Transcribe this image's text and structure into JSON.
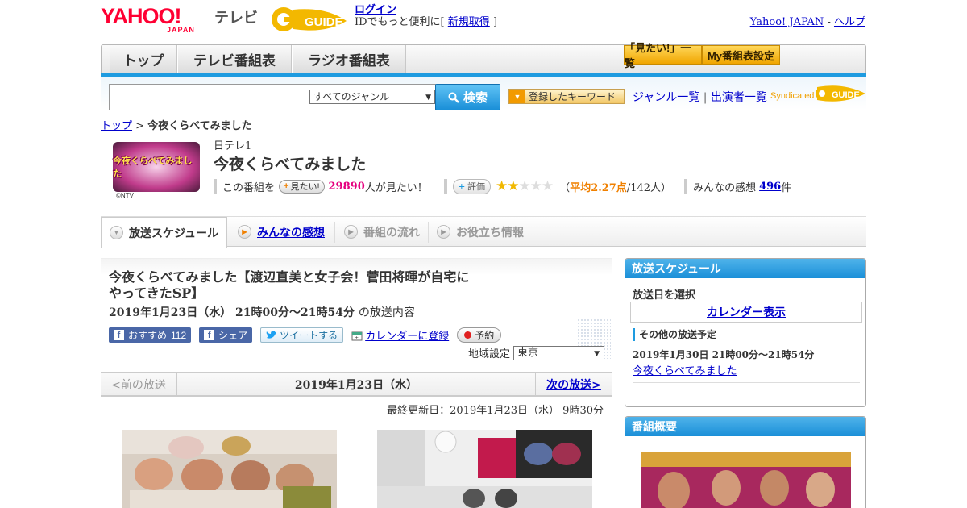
{
  "header": {
    "yahoo_logo": "YAHOO!",
    "yahoo_logo_sub": "JAPAN",
    "tv_label": "テレビ",
    "gguide_logo": "GUIDE",
    "login": "ログイン",
    "login_note_pre": "IDでもっと便利に[",
    "signup": "新規取得",
    "login_note_post": "]",
    "yahoo_japan_link": "Yahoo! JAPAN",
    "help_link": "ヘルプ",
    "sep": "-"
  },
  "nav": {
    "tabs": [
      {
        "label": "トップ"
      },
      {
        "label": "テレビ番組表"
      },
      {
        "label": "ラジオ番組表"
      }
    ],
    "mitai_list": "「見たい!」一覧",
    "my_schedule": "My番組表設定"
  },
  "search": {
    "genre_selected": "すべてのジャンル",
    "button": "検索",
    "keyword_button": "登録したキーワード",
    "genre_list": "ジャンル一覧",
    "cast_list": "出演者一覧",
    "syndicated": "Syndicated"
  },
  "breadcrumb": {
    "top": "トップ",
    "sep": ">",
    "current": "今夜くらべてみました"
  },
  "program": {
    "logo_text": "今夜くらべてみました",
    "copyright": "©NTV",
    "channel": "日テレ1",
    "title": "今夜くらべてみました",
    "mitai_pre": "この番組を",
    "mitai_button": "見たい!",
    "mitai_count": "29890",
    "mitai_post": "人が見たい！",
    "rating_button": "評価",
    "rating_value": 2.27,
    "rating_open": "（",
    "rating_avg": "平均2.27点",
    "rating_count": "/142人）",
    "impressions_pre": "みんなの感想",
    "impressions_count": "496",
    "impressions_post": "件"
  },
  "tabs": [
    {
      "label": "放送スケジュール"
    },
    {
      "label": "みんなの感想"
    },
    {
      "label": "番組の流れ"
    },
    {
      "label": "お役立ち情報"
    }
  ],
  "episode": {
    "title": "今夜くらべてみました【渡辺直美と女子会！菅田将暉が自宅にやってきたSP】",
    "datetime": "2019年1月23日（水） 21時00分～21時54分",
    "datetime_suffix": "の放送内容",
    "fb_recommend": "おすすめ",
    "fb_count": "112",
    "fb_share": "シェア",
    "tweet": "ツイートする",
    "calendar": "カレンダーに登録",
    "reserve": "予約",
    "region_label": "地域設定",
    "region_selected": "東京"
  },
  "date_nav": {
    "prev": "<前の放送",
    "current": "2019年1月23日（水）",
    "next": "次の放送>"
  },
  "updated": "最終更新日：2019年1月23日（水） 9時30分",
  "sidebar": {
    "schedule_title": "放送スケジュール",
    "select_date": "放送日を選択",
    "calendar_link": "カレンダー表示",
    "other_label": "その他の放送予定",
    "other_time": "2019年1月30日 21時00分～21時54分",
    "other_link": "今夜くらべてみました",
    "overview_title": "番組概要"
  },
  "colors": {
    "accent_blue": "#1e9be0",
    "link": "#0000cc",
    "pink": "#e5007f",
    "orange": "#f08000"
  }
}
